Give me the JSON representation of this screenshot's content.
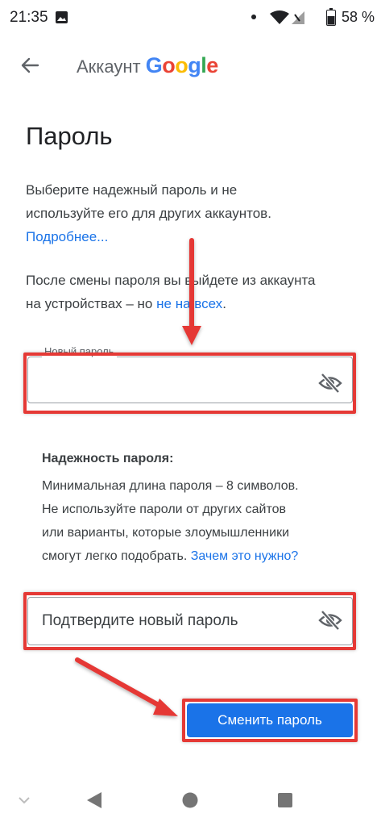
{
  "status_bar": {
    "time": "21:35",
    "battery_percent": "58 %"
  },
  "header": {
    "account_prefix": "Аккаунт",
    "google_letters": [
      {
        "ch": "G",
        "color": "#4285F4"
      },
      {
        "ch": "o",
        "color": "#EA4335"
      },
      {
        "ch": "o",
        "color": "#FBBC05"
      },
      {
        "ch": "g",
        "color": "#4285F4"
      },
      {
        "ch": "l",
        "color": "#34A853"
      },
      {
        "ch": "e",
        "color": "#EA4335"
      }
    ]
  },
  "page": {
    "title": "Пароль",
    "intro_line1": "Выберите надежный пароль и не",
    "intro_line2": "используйте его для других аккаунтов.",
    "more_link": "Подробнее...",
    "logout_line1": "После смены пароля вы выйдете из аккаунта",
    "logout_line2_prefix": "на устройствах – но ",
    "logout_link": "не на всех",
    "logout_line2_suffix": "."
  },
  "new_password": {
    "label": "Новый пароль",
    "value": ""
  },
  "strength": {
    "title": "Надежность пароля:",
    "line1": "Минимальная длина пароля – 8 символов.",
    "line2": "Не используйте пароли от других сайтов",
    "line3": "или варианты, которые злоумышленники",
    "line4_prefix": "смогут легко подобрать. ",
    "line4_link": "Зачем это нужно?"
  },
  "confirm_password": {
    "placeholder": "Подтвердите новый пароль"
  },
  "submit": {
    "label": "Сменить пароль"
  },
  "colors": {
    "accent": "#1a73e8",
    "annotation_red": "#e53935"
  },
  "icons": [
    "back-arrow-icon",
    "visibility-off-icon",
    "image-icon",
    "wifi-icon",
    "signal-icon",
    "battery-icon",
    "nav-back-icon",
    "nav-home-icon",
    "nav-recents-icon"
  ]
}
